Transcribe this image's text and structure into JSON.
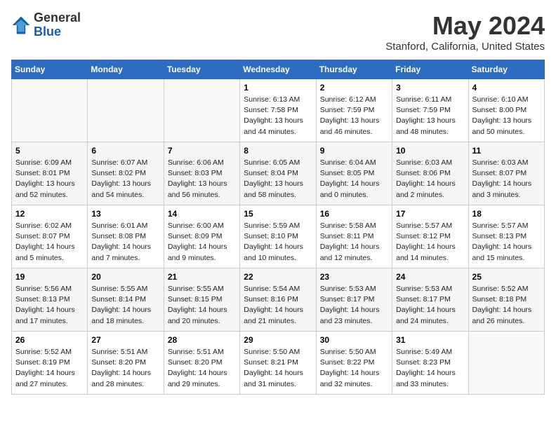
{
  "header": {
    "logo_general": "General",
    "logo_blue": "Blue",
    "month_year": "May 2024",
    "location": "Stanford, California, United States"
  },
  "weekdays": [
    "Sunday",
    "Monday",
    "Tuesday",
    "Wednesday",
    "Thursday",
    "Friday",
    "Saturday"
  ],
  "weeks": [
    [
      {
        "day": "",
        "info": ""
      },
      {
        "day": "",
        "info": ""
      },
      {
        "day": "",
        "info": ""
      },
      {
        "day": "1",
        "info": "Sunrise: 6:13 AM\nSunset: 7:58 PM\nDaylight: 13 hours\nand 44 minutes."
      },
      {
        "day": "2",
        "info": "Sunrise: 6:12 AM\nSunset: 7:59 PM\nDaylight: 13 hours\nand 46 minutes."
      },
      {
        "day": "3",
        "info": "Sunrise: 6:11 AM\nSunset: 7:59 PM\nDaylight: 13 hours\nand 48 minutes."
      },
      {
        "day": "4",
        "info": "Sunrise: 6:10 AM\nSunset: 8:00 PM\nDaylight: 13 hours\nand 50 minutes."
      }
    ],
    [
      {
        "day": "5",
        "info": "Sunrise: 6:09 AM\nSunset: 8:01 PM\nDaylight: 13 hours\nand 52 minutes."
      },
      {
        "day": "6",
        "info": "Sunrise: 6:07 AM\nSunset: 8:02 PM\nDaylight: 13 hours\nand 54 minutes."
      },
      {
        "day": "7",
        "info": "Sunrise: 6:06 AM\nSunset: 8:03 PM\nDaylight: 13 hours\nand 56 minutes."
      },
      {
        "day": "8",
        "info": "Sunrise: 6:05 AM\nSunset: 8:04 PM\nDaylight: 13 hours\nand 58 minutes."
      },
      {
        "day": "9",
        "info": "Sunrise: 6:04 AM\nSunset: 8:05 PM\nDaylight: 14 hours\nand 0 minutes."
      },
      {
        "day": "10",
        "info": "Sunrise: 6:03 AM\nSunset: 8:06 PM\nDaylight: 14 hours\nand 2 minutes."
      },
      {
        "day": "11",
        "info": "Sunrise: 6:03 AM\nSunset: 8:07 PM\nDaylight: 14 hours\nand 3 minutes."
      }
    ],
    [
      {
        "day": "12",
        "info": "Sunrise: 6:02 AM\nSunset: 8:07 PM\nDaylight: 14 hours\nand 5 minutes."
      },
      {
        "day": "13",
        "info": "Sunrise: 6:01 AM\nSunset: 8:08 PM\nDaylight: 14 hours\nand 7 minutes."
      },
      {
        "day": "14",
        "info": "Sunrise: 6:00 AM\nSunset: 8:09 PM\nDaylight: 14 hours\nand 9 minutes."
      },
      {
        "day": "15",
        "info": "Sunrise: 5:59 AM\nSunset: 8:10 PM\nDaylight: 14 hours\nand 10 minutes."
      },
      {
        "day": "16",
        "info": "Sunrise: 5:58 AM\nSunset: 8:11 PM\nDaylight: 14 hours\nand 12 minutes."
      },
      {
        "day": "17",
        "info": "Sunrise: 5:57 AM\nSunset: 8:12 PM\nDaylight: 14 hours\nand 14 minutes."
      },
      {
        "day": "18",
        "info": "Sunrise: 5:57 AM\nSunset: 8:13 PM\nDaylight: 14 hours\nand 15 minutes."
      }
    ],
    [
      {
        "day": "19",
        "info": "Sunrise: 5:56 AM\nSunset: 8:13 PM\nDaylight: 14 hours\nand 17 minutes."
      },
      {
        "day": "20",
        "info": "Sunrise: 5:55 AM\nSunset: 8:14 PM\nDaylight: 14 hours\nand 18 minutes."
      },
      {
        "day": "21",
        "info": "Sunrise: 5:55 AM\nSunset: 8:15 PM\nDaylight: 14 hours\nand 20 minutes."
      },
      {
        "day": "22",
        "info": "Sunrise: 5:54 AM\nSunset: 8:16 PM\nDaylight: 14 hours\nand 21 minutes."
      },
      {
        "day": "23",
        "info": "Sunrise: 5:53 AM\nSunset: 8:17 PM\nDaylight: 14 hours\nand 23 minutes."
      },
      {
        "day": "24",
        "info": "Sunrise: 5:53 AM\nSunset: 8:17 PM\nDaylight: 14 hours\nand 24 minutes."
      },
      {
        "day": "25",
        "info": "Sunrise: 5:52 AM\nSunset: 8:18 PM\nDaylight: 14 hours\nand 26 minutes."
      }
    ],
    [
      {
        "day": "26",
        "info": "Sunrise: 5:52 AM\nSunset: 8:19 PM\nDaylight: 14 hours\nand 27 minutes."
      },
      {
        "day": "27",
        "info": "Sunrise: 5:51 AM\nSunset: 8:20 PM\nDaylight: 14 hours\nand 28 minutes."
      },
      {
        "day": "28",
        "info": "Sunrise: 5:51 AM\nSunset: 8:20 PM\nDaylight: 14 hours\nand 29 minutes."
      },
      {
        "day": "29",
        "info": "Sunrise: 5:50 AM\nSunset: 8:21 PM\nDaylight: 14 hours\nand 31 minutes."
      },
      {
        "day": "30",
        "info": "Sunrise: 5:50 AM\nSunset: 8:22 PM\nDaylight: 14 hours\nand 32 minutes."
      },
      {
        "day": "31",
        "info": "Sunrise: 5:49 AM\nSunset: 8:23 PM\nDaylight: 14 hours\nand 33 minutes."
      },
      {
        "day": "",
        "info": ""
      }
    ]
  ]
}
